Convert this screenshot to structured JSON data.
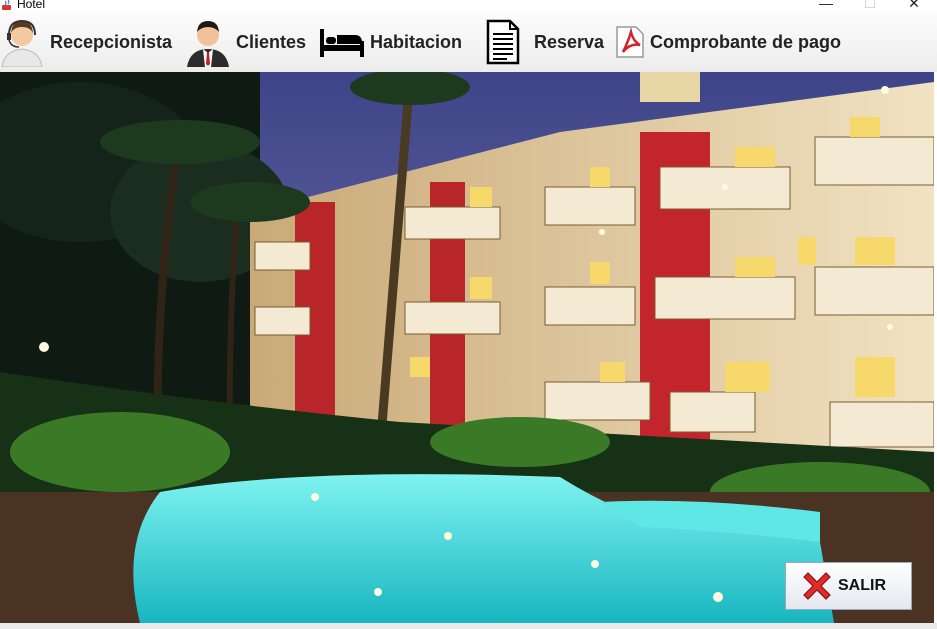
{
  "window": {
    "title": "Hotel",
    "min_glyph": "—",
    "max_glyph": "☐",
    "close_glyph": "✕"
  },
  "menu": [
    {
      "label": "Recepcionista",
      "icon": "receptionist-icon"
    },
    {
      "label": "Clientes",
      "icon": "businessman-icon"
    },
    {
      "label": "Habitacion",
      "icon": "bed-icon"
    },
    {
      "label": "Reserva",
      "icon": "document-icon"
    },
    {
      "label": "Comprobante de pago",
      "icon": "pdf-icon"
    }
  ],
  "exit_button": {
    "label": "SALIR",
    "icon": "red-x-icon"
  },
  "colors": {
    "sky": "#4a4f8f",
    "pool": "#2fd6d2",
    "wall": "#e9d9b5",
    "accent_red": "#c2262c"
  }
}
